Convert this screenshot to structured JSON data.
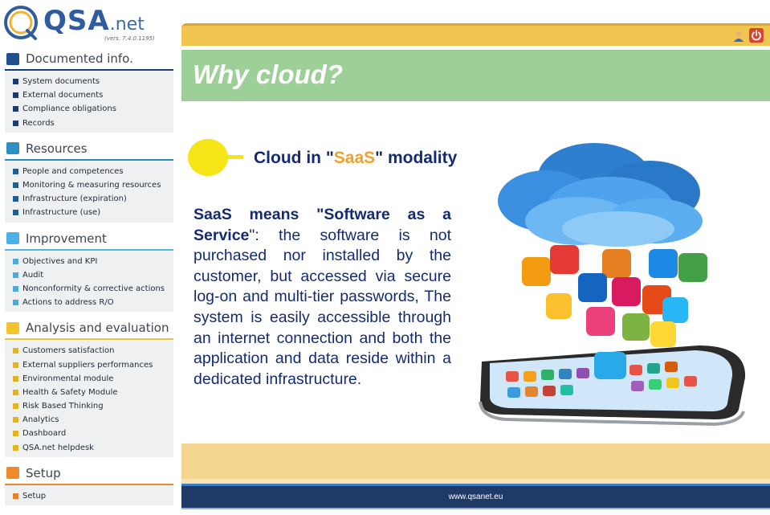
{
  "logo": {
    "brand": "QSA",
    "brand_suffix": ".net",
    "version": "(vers. 7.4.0.1195)"
  },
  "sidebar": {
    "sections": [
      {
        "title": "Documented info.",
        "color": "#1b3d6e",
        "icon": "document-icon",
        "items": [
          "System documents",
          "External documents",
          "Compliance obligations",
          "Records"
        ]
      },
      {
        "title": "Resources",
        "color": "#2a8bbf",
        "icon": "resources-icon",
        "items": [
          "People and competences",
          "Monitoring & measuring resources",
          "Infrastructure (expiration)",
          "Infrastructure (use)"
        ]
      },
      {
        "title": "Improvement",
        "color": "#56b6e0",
        "icon": "improvement-icon",
        "items": [
          "Objectives and KPI",
          "Audit",
          "Nonconformity & corrective actions",
          "Actions to address R/O"
        ]
      },
      {
        "title": "Analysis and evaluation",
        "color": "#e8c43a",
        "icon": "analysis-icon",
        "items": [
          "Customers satisfaction",
          "External suppliers performances",
          "Environmental module",
          "Health & Safety Module",
          "Risk Based Thinking",
          "Analytics",
          "Dashboard",
          "QSA.net helpdesk"
        ]
      },
      {
        "title": "Setup",
        "color": "#e58a2c",
        "icon": "setup-icon",
        "items": [
          "Setup"
        ]
      }
    ]
  },
  "topbar": {
    "user_icon": "user-icon",
    "power_icon": "power-icon"
  },
  "slide": {
    "title": "Why cloud?",
    "subtitle_pre": "Cloud in \"",
    "subtitle_highlight": "SaaS",
    "subtitle_post": "\" modality",
    "body_bold": "SaaS means \"Software as a Service",
    "body_rest": "\": the software is not purchased nor installed by the customer, but accessed via secure log-on and multi-tier passwords, The system is easily accessible through an internet connection and both the application and data reside within a dedicated infrastructure.",
    "illustration": "cloud-apps-smartphone-illustration"
  },
  "footer": {
    "url": "www.qsanet.eu"
  }
}
